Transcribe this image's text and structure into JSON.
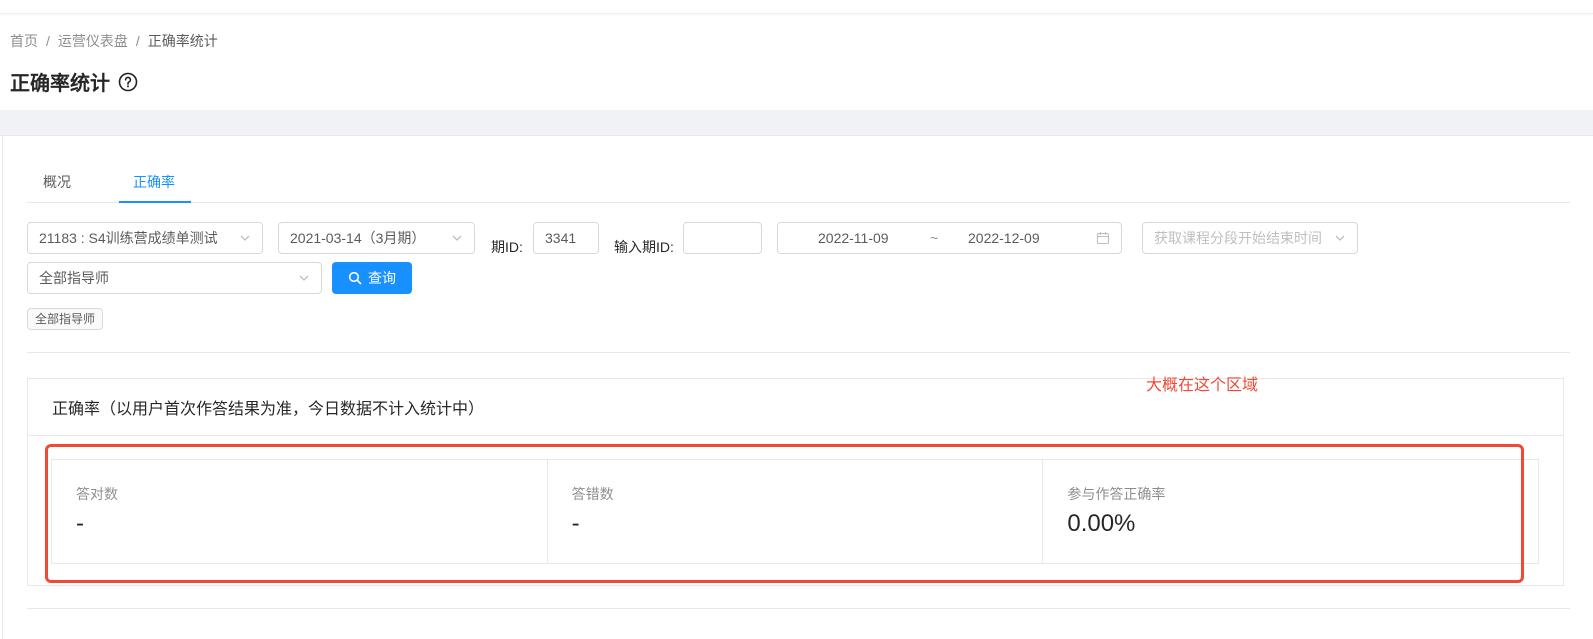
{
  "breadcrumb": {
    "items": [
      "首页",
      "运营仪表盘"
    ],
    "current": "正确率统计",
    "separator": "/"
  },
  "page": {
    "title": "正确率统计"
  },
  "tabs": [
    {
      "label": "概况",
      "active": false
    },
    {
      "label": "正确率",
      "active": true
    }
  ],
  "filters": {
    "course_select": "21183 : S4训练营成绩单测试",
    "period_select": "2021-03-14（3月期）",
    "period_id_label": "期ID:",
    "period_id_value": "3341",
    "input_period_id_label": "输入期ID:",
    "input_period_id_value": "",
    "date_start": "2022-11-09",
    "date_separator": "~",
    "date_end": "2022-12-09",
    "segment_placeholder": "获取课程分段开始结束时间",
    "tutor_select": "全部指导师",
    "query_button": "查询",
    "active_tag": "全部指导师"
  },
  "card": {
    "title": "正确率（以用户首次作答结果为准，今日数据不计入统计中）",
    "stats": [
      {
        "label": "答对数",
        "value": "-"
      },
      {
        "label": "答错数",
        "value": "-"
      },
      {
        "label": "参与作答正确率",
        "value": "0.00%"
      }
    ]
  },
  "annotation": {
    "text": "大概在这个区域",
    "color": "#f04a37"
  },
  "colors": {
    "primary": "#1890ff",
    "annotation": "#f04a37",
    "page_bg": "#f0f2f5"
  }
}
